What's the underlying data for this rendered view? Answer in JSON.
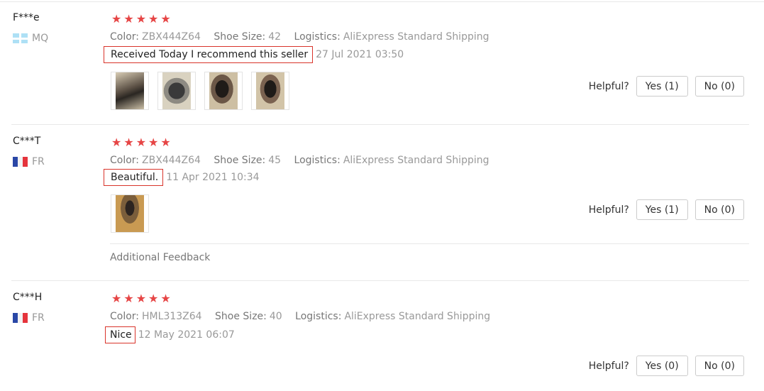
{
  "labels": {
    "color": "Color:",
    "shoe_size": "Shoe Size:",
    "logistics": "Logistics:",
    "helpful": "Helpful?",
    "additional_feedback": "Additional Feedback"
  },
  "rating_color": "#e64545",
  "reviews": [
    {
      "user": "F***e",
      "country": "MQ",
      "flag_icon": "martinique-flag-icon",
      "stars": 5,
      "color": "ZBX444Z64",
      "shoe_size": "42",
      "logistics": "AliExpress Standard Shipping",
      "comment": "Received Today I recommend this seller",
      "date": "27 Jul 2021 03:50",
      "yes": "Yes (1)",
      "no": "No (0)",
      "photo_count": 4
    },
    {
      "user": "C***T",
      "country": "FR",
      "flag_icon": "france-flag-icon",
      "stars": 5,
      "color": "ZBX444Z64",
      "shoe_size": "45",
      "logistics": "AliExpress Standard Shipping",
      "comment": "Beautiful.",
      "date": "11 Apr 2021 10:34",
      "yes": "Yes (1)",
      "no": "No (0)",
      "photo_count": 1
    },
    {
      "user": "C***H",
      "country": "FR",
      "flag_icon": "france-flag-icon",
      "stars": 5,
      "color": "HML313Z64",
      "shoe_size": "40",
      "logistics": "AliExpress Standard Shipping",
      "comment": "Nice",
      "date": "12 May 2021 06:07",
      "yes": "Yes (0)",
      "no": "No (0)",
      "photo_count": 0
    }
  ]
}
